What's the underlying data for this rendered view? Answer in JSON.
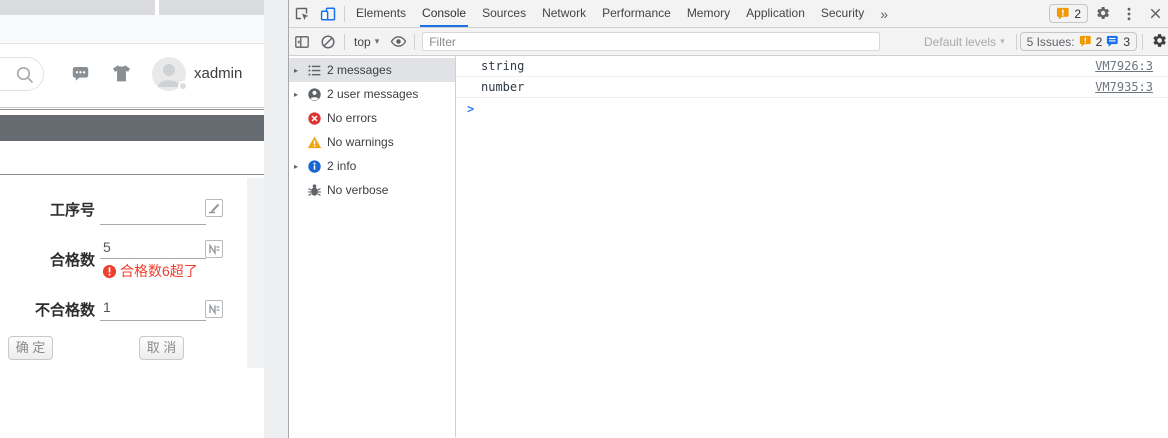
{
  "page": {
    "topbar": {
      "username": "xadmin"
    },
    "form": {
      "fields": [
        {
          "label": "工序号",
          "value": "",
          "icon": "edit-field"
        },
        {
          "label": "合格数",
          "value": "5",
          "icon": "number-field",
          "error": "合格数6超了"
        },
        {
          "label": "不合格数",
          "value": "1",
          "icon": "number-field"
        }
      ],
      "confirm_label": "确 定",
      "cancel_label": "取 消",
      "error_color": "#ee3f2f"
    }
  },
  "devtools": {
    "tabs": [
      {
        "label": "Elements"
      },
      {
        "label": "Console",
        "selected": true
      },
      {
        "label": "Sources"
      },
      {
        "label": "Network"
      },
      {
        "label": "Performance"
      },
      {
        "label": "Memory"
      },
      {
        "label": "Application"
      },
      {
        "label": "Security"
      }
    ],
    "more_tabs_symbol": "»",
    "issue_badge_count": "2",
    "accent_blue": "#1a73e8",
    "toolbar": {
      "context_label": "top",
      "context_caret": "▾",
      "filter_placeholder": "Filter",
      "levels_label": "Default levels",
      "levels_caret": "▾",
      "issues_label": "5 Issues:",
      "issues_error_count": "2",
      "issues_info_count": "3"
    },
    "sidebar": [
      {
        "label": "2 messages",
        "icon": "list-icon",
        "expandable": true,
        "selected": true
      },
      {
        "label": "2 user messages",
        "icon": "user-icon",
        "expandable": true
      },
      {
        "label": "No errors",
        "icon": "error-icon"
      },
      {
        "label": "No warnings",
        "icon": "warning-icon"
      },
      {
        "label": "2 info",
        "icon": "info-icon",
        "expandable": true
      },
      {
        "label": "No verbose",
        "icon": "verbose-icon"
      }
    ],
    "expand_arrow": "▸",
    "messages": [
      {
        "text": "string",
        "source": "VM7926:3"
      },
      {
        "text": "number",
        "source": "VM7935:3"
      }
    ],
    "prompt_symbol": ">"
  }
}
